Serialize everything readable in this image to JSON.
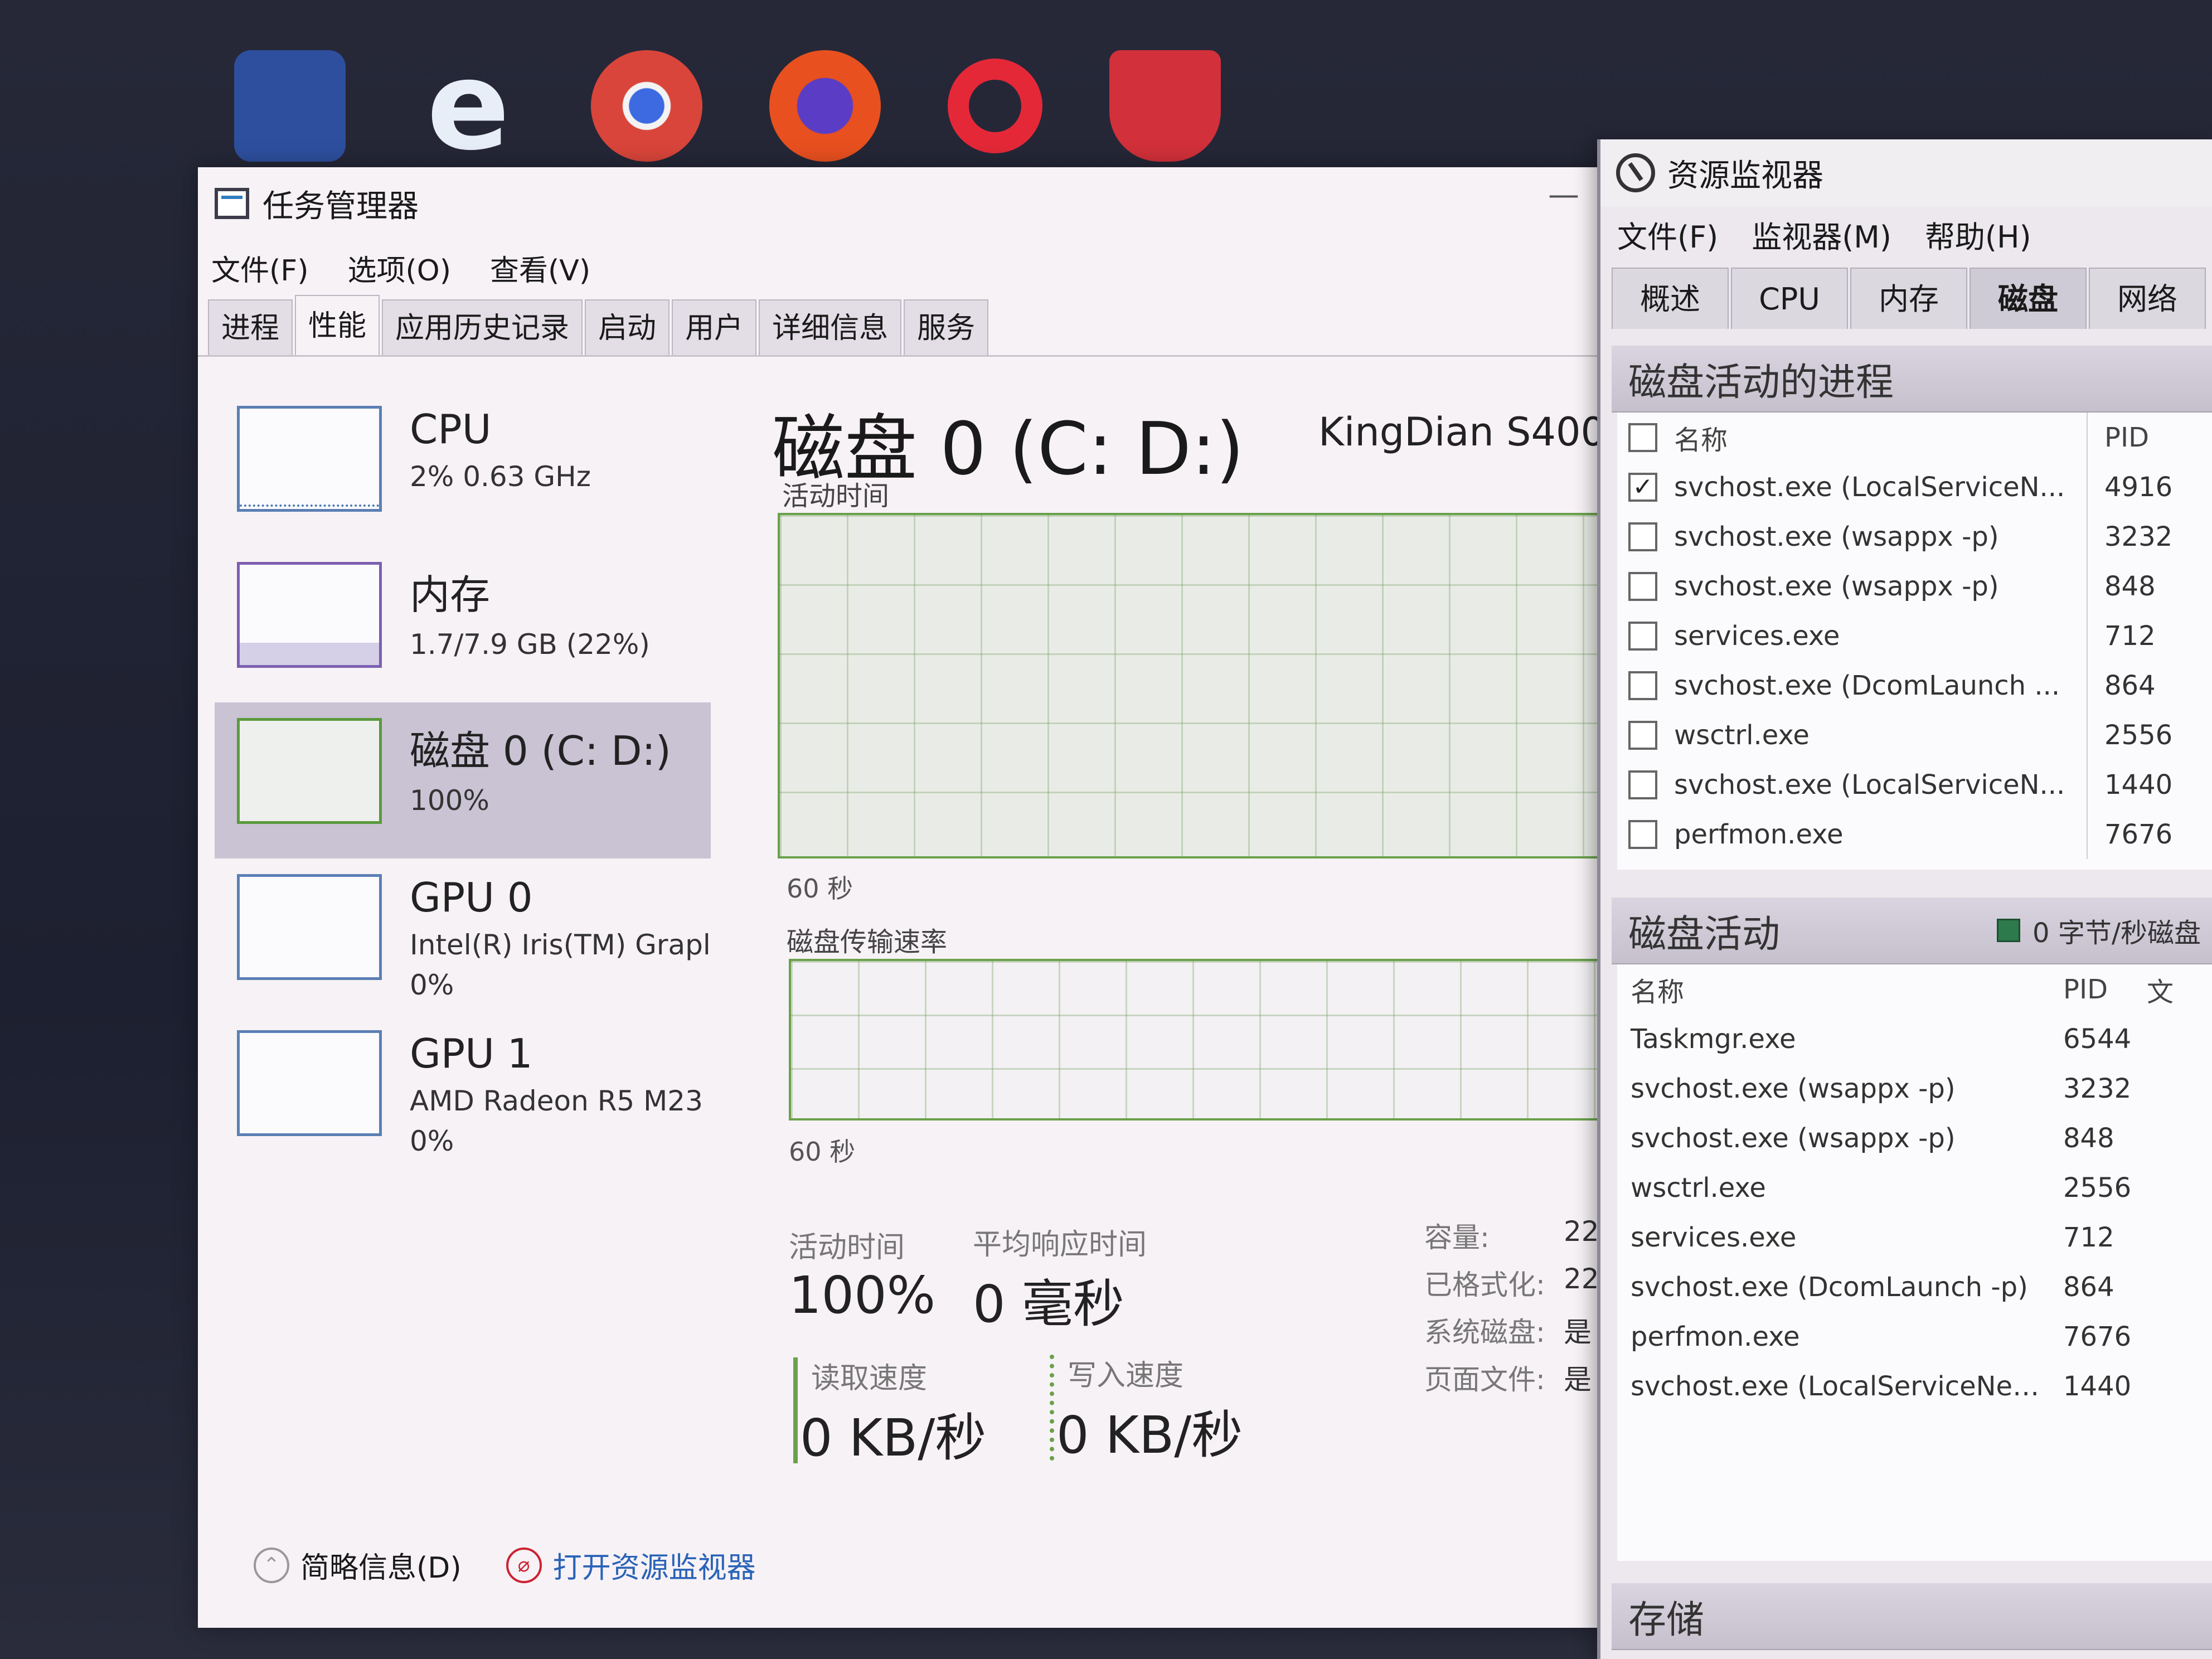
{
  "colors": {
    "accent_cpu": "#5b7fb5",
    "accent_memory": "#7b5fb2",
    "accent_disk": "#5a9a3c",
    "link": "#2a63b8",
    "legend_green": "#2d7a4d"
  },
  "taskbar": {
    "icons": [
      "blue-app-icon",
      "edge-icon",
      "chrome-icon",
      "firefox-icon",
      "opera-icon",
      "shield-icon"
    ],
    "edge_glyph": "e"
  },
  "task_manager": {
    "title": "任务管理器",
    "minimize_glyph": "—",
    "menu": [
      "文件(F)",
      "选项(O)",
      "查看(V)"
    ],
    "tabs": [
      "进程",
      "性能",
      "应用历史记录",
      "启动",
      "用户",
      "详细信息",
      "服务"
    ],
    "active_tab": "性能",
    "perf_items": [
      {
        "title": "CPU",
        "sub": "2% 0.63 GHz"
      },
      {
        "title": "内存",
        "sub": "1.7/7.9 GB (22%)",
        "fraction": 0.22
      },
      {
        "title": "磁盘 0 (C: D:)",
        "sub": "100%"
      },
      {
        "title": "GPU 0",
        "sub": "Intel(R) Iris(TM) Grapl",
        "sub2": "0%"
      },
      {
        "title": "GPU 1",
        "sub": "AMD Radeon R5 M23",
        "sub2": "0%"
      }
    ],
    "detail": {
      "title": "磁盘 0 (C: D:)",
      "model": "KingDian S400",
      "graph1_label": "活动时间",
      "graph1_axis": "60 秒",
      "graph2_label": "磁盘传输速率",
      "graph2_axis": "60 秒",
      "active_time_label": "活动时间",
      "active_time_value": "100%",
      "avg_response_label": "平均响应时间",
      "avg_response_value": "0 毫秒",
      "read_speed_label": "读取速度",
      "read_speed_value": "0 KB/秒",
      "write_speed_label": "写入速度",
      "write_speed_value": "0 KB/秒",
      "meta": [
        {
          "label": "容量:",
          "value": "22"
        },
        {
          "label": "已格式化:",
          "value": "22"
        },
        {
          "label": "系统磁盘:",
          "value": "是"
        },
        {
          "label": "页面文件:",
          "value": "是"
        }
      ]
    },
    "footer": {
      "brief_label": "简略信息(D)",
      "open_monitor_label": "打开资源监视器"
    }
  },
  "resource_monitor": {
    "title": "资源监视器",
    "menu": [
      "文件(F)",
      "监视器(M)",
      "帮助(H)"
    ],
    "tabs": [
      "概述",
      "CPU",
      "内存",
      "磁盘",
      "网络"
    ],
    "active_tab": "磁盘",
    "processes_section": {
      "title": "磁盘活动的进程",
      "col_name": "名称",
      "col_pid": "PID",
      "rows": [
        {
          "name": "svchost.exe (LocalServiceN...",
          "pid": "4916",
          "checked": true
        },
        {
          "name": "svchost.exe (wsappx -p)",
          "pid": "3232",
          "checked": false
        },
        {
          "name": "svchost.exe (wsappx -p)",
          "pid": "848",
          "checked": false
        },
        {
          "name": "services.exe",
          "pid": "712",
          "checked": false
        },
        {
          "name": "svchost.exe (DcomLaunch ...",
          "pid": "864",
          "checked": false
        },
        {
          "name": "wsctrl.exe",
          "pid": "2556",
          "checked": false
        },
        {
          "name": "svchost.exe (LocalServiceN...",
          "pid": "1440",
          "checked": false
        },
        {
          "name": "perfmon.exe",
          "pid": "7676",
          "checked": false
        }
      ]
    },
    "activity_section": {
      "title": "磁盘活动",
      "legend": "0 字节/秒磁盘",
      "col_name": "名称",
      "col_pid": "PID",
      "col_file": "文",
      "rows": [
        {
          "name": "Taskmgr.exe",
          "pid": "6544"
        },
        {
          "name": "svchost.exe (wsappx -p)",
          "pid": "3232"
        },
        {
          "name": "svchost.exe (wsappx -p)",
          "pid": "848"
        },
        {
          "name": "wsctrl.exe",
          "pid": "2556"
        },
        {
          "name": "services.exe",
          "pid": "712"
        },
        {
          "name": "svchost.exe (DcomLaunch -p)",
          "pid": "864"
        },
        {
          "name": "perfmon.exe",
          "pid": "7676"
        },
        {
          "name": "svchost.exe (LocalServiceNet...",
          "pid": "1440"
        }
      ]
    },
    "storage_section": {
      "title": "存储"
    }
  }
}
